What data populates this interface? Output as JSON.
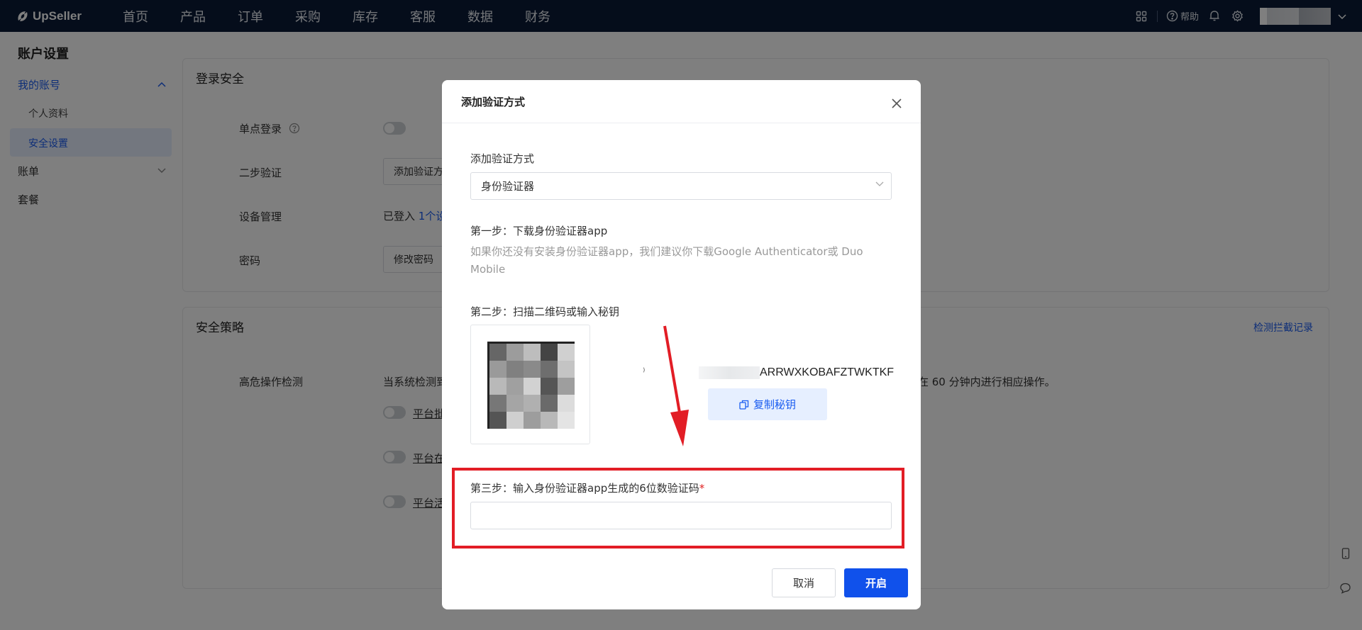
{
  "topnav": {
    "logo_text": "UpSeller",
    "items": [
      "首页",
      "产品",
      "订单",
      "采购",
      "库存",
      "客服",
      "数据",
      "财务"
    ],
    "help_label": "帮助"
  },
  "sidebar": {
    "title": "账户设置",
    "my_account": "我的账号",
    "profile": "个人资料",
    "security": "安全设置",
    "billing": "账单",
    "plan": "套餐"
  },
  "login_security": {
    "title": "登录安全",
    "sso_label": "单点登录",
    "two_step_label": "二步验证",
    "two_step_button": "添加验证方",
    "device_label": "设备管理",
    "device_text": "已登入",
    "device_link": "1个设",
    "password_label": "密码",
    "password_button": "修改密码"
  },
  "security_policy": {
    "title": "安全策略",
    "detect_link": "检测拦截记录",
    "risk_label": "高危操作检测",
    "risk_text_left": "当系统检测到",
    "risk_text_right": "在 60 分钟内进行相应操作。",
    "option1": "平台批",
    "option2": "平台在",
    "option3": "平台活"
  },
  "modal": {
    "title": "添加验证方式",
    "method_label": "添加验证方式",
    "method_value": "身份验证器",
    "step1_title": "第一步：下载身份验证器app",
    "step1_desc": "如果你还没有安装身份验证器app，我们建议你下载Google Authenticator或 Duo Mobile",
    "step2_title": "第二步：扫描二维码或输入秘钥",
    "secret_key_visible": "ARRWXKOBAFZTWKTKF",
    "copy_key_label": "复制秘钥",
    "step3_title": "第三步：输入身份验证器app生成的6位数验证码",
    "required_mark": "*",
    "code_value": "",
    "cancel_label": "取消",
    "enable_label": "开启"
  },
  "colors": {
    "nav_bg": "#0a1a36",
    "primary": "#1051eb",
    "highlight_red": "#e21d25"
  }
}
